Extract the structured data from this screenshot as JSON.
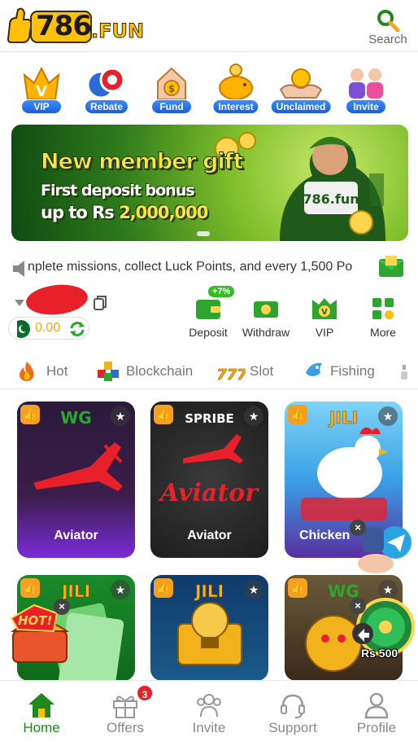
{
  "header": {
    "logo_number": "786",
    "logo_suffix": ".FUN",
    "search_label": "Search"
  },
  "quicknav": [
    {
      "label": "VIP",
      "icon": "vip-crown-icon"
    },
    {
      "label": "Rebate",
      "icon": "poker-chips-icon"
    },
    {
      "label": "Fund",
      "icon": "money-bag-icon"
    },
    {
      "label": "Interest",
      "icon": "piggy-bank-icon"
    },
    {
      "label": "Unclaimed",
      "icon": "hands-coin-icon"
    },
    {
      "label": "Invite",
      "icon": "people-icon"
    }
  ],
  "banner": {
    "headline": "New member gift",
    "line2": "First deposit bonus",
    "line3_prefix": "up to Rs ",
    "line3_amount": "2,000,000",
    "hero_badge": "786.fun"
  },
  "marquee": {
    "text": "nplete missions, collect Luck Points, and every 1,500 Po"
  },
  "account": {
    "balance": "0.00",
    "currency_flag": "pakistan-flag-icon"
  },
  "actions": [
    {
      "label": "Deposit",
      "icon": "wallet-icon",
      "badge": "+7%"
    },
    {
      "label": "Withdraw",
      "icon": "cash-icon"
    },
    {
      "label": "VIP",
      "icon": "vip-shield-icon"
    },
    {
      "label": "More",
      "icon": "grid-icon"
    }
  ],
  "tabs": [
    {
      "label": "Hot",
      "icon": "flame-icon"
    },
    {
      "label": "Blockchain",
      "icon": "cubes-icon"
    },
    {
      "label": "Slot",
      "icon": "777-icon"
    },
    {
      "label": "Fishing",
      "icon": "fish-icon"
    }
  ],
  "games": [
    {
      "name": "Aviator",
      "brand": "WG"
    },
    {
      "name": "Aviator",
      "brand": "SPRIBE"
    },
    {
      "name": "Chicken",
      "brand": "JILI"
    },
    {
      "name": "",
      "brand": "JILI"
    },
    {
      "name": "",
      "brand": "JILI"
    },
    {
      "name": "",
      "brand": "WG"
    }
  ],
  "floating": {
    "hot_label": "HOT!",
    "wheel_reward": "Rs 500"
  },
  "bottomnav": [
    {
      "label": "Home",
      "icon": "home-icon",
      "active": true
    },
    {
      "label": "Offers",
      "icon": "gift-icon",
      "badge": "3"
    },
    {
      "label": "Invite",
      "icon": "people-icon"
    },
    {
      "label": "Support",
      "icon": "headset-icon"
    },
    {
      "label": "Profile",
      "icon": "user-icon"
    }
  ],
  "colors": {
    "brand_green": "#1e8a1e",
    "accent_yellow": "#ffc107",
    "balance_orange": "#f5a623",
    "badge_red": "#e8202a"
  }
}
